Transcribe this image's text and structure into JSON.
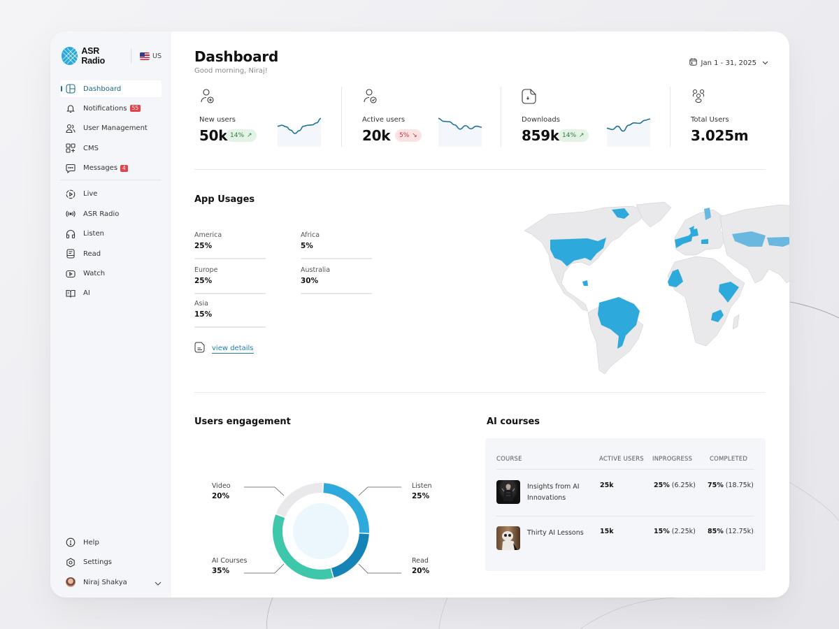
{
  "app": {
    "brand": "ASR Radio",
    "locale": "US"
  },
  "sidebar": {
    "primary": [
      {
        "label": "Dashboard",
        "icon": "layout-icon",
        "active": true
      },
      {
        "label": "Notifications",
        "icon": "bell-icon",
        "badge": "55"
      },
      {
        "label": "User Management",
        "icon": "users-icon"
      },
      {
        "label": "CMS",
        "icon": "grid-plus-icon"
      },
      {
        "label": "Messages",
        "icon": "message-icon",
        "badge": "4"
      }
    ],
    "secondary": [
      {
        "label": "Live",
        "icon": "live-play-icon"
      },
      {
        "label": "ASR Radio",
        "icon": "broadcast-icon"
      },
      {
        "label": "Listen",
        "icon": "headphones-icon"
      },
      {
        "label": "Read",
        "icon": "document-icon"
      },
      {
        "label": "Watch",
        "icon": "video-icon"
      },
      {
        "label": "AI",
        "icon": "book-open-icon"
      }
    ],
    "bottom": [
      {
        "label": "Help",
        "icon": "info-circle-icon"
      },
      {
        "label": "Settings",
        "icon": "settings-icon"
      }
    ],
    "user": {
      "name": "Niraj Shakya"
    }
  },
  "header": {
    "title": "Dashboard",
    "greeting": "Good morning, Niraj!",
    "date_range": "Jan 1 - 31, 2025"
  },
  "stats": [
    {
      "label": "New users",
      "value": "50k",
      "trend": "14%",
      "direction": "up",
      "icon": "user-add-icon",
      "spark": [
        0.55,
        0.6,
        0.52,
        0.35,
        0.18,
        0.32,
        0.55,
        0.6,
        0.62,
        0.72,
        0.95
      ]
    },
    {
      "label": "Active users",
      "value": "20k",
      "trend": "5%",
      "direction": "down",
      "icon": "user-check-icon",
      "spark": [
        0.95,
        0.8,
        0.78,
        0.62,
        0.4,
        0.58,
        0.42,
        0.55,
        0.5
      ]
    },
    {
      "label": "Downloads",
      "value": "859k",
      "trend": "14%",
      "direction": "up",
      "icon": "file-download-icon",
      "spark": [
        0.45,
        0.38,
        0.55,
        0.3,
        0.6,
        0.72,
        0.7,
        0.85,
        0.92
      ]
    },
    {
      "label": "Total Users",
      "value": "3.025m",
      "icon": "group-icon"
    }
  ],
  "app_usage": {
    "title": "App Usages",
    "regions": [
      {
        "name": "America",
        "value": "25%"
      },
      {
        "name": "Africa",
        "value": "5%"
      },
      {
        "name": "Europe",
        "value": "25%"
      },
      {
        "name": "Australia",
        "value": "30%"
      },
      {
        "name": "Asia",
        "value": "15%"
      }
    ],
    "link": "view details",
    "highlight_color": "#2ea9dc",
    "highlight_light": "#6ab8e0",
    "land_color": "#e9e9eb"
  },
  "engagement": {
    "title": "Users engagement",
    "segments": [
      {
        "name": "Listen",
        "value": 25,
        "label": "25%",
        "color": "#2ea9dc"
      },
      {
        "name": "Read",
        "value": 20,
        "label": "20%",
        "color": "#1683b7"
      },
      {
        "name": "AI Courses",
        "value": 35,
        "label": "35%",
        "color": "#3ec7ab"
      },
      {
        "name": "Video",
        "value": 20,
        "label": "20%",
        "color": "#e9e9eb"
      }
    ]
  },
  "ai_courses": {
    "title": "AI courses",
    "columns": [
      "COURSE",
      "ACTIVE USERS",
      "INPROGRESS",
      "COMPLETED"
    ],
    "rows": [
      {
        "course": "Insights from AI Innovations",
        "active_users": "25k",
        "inprogress_pct": "25%",
        "inprogress_count": "(6.25k)",
        "completed_pct": "75%",
        "completed_count": "(18.75k)"
      },
      {
        "course": "Thirty AI Lessons",
        "active_users": "15k",
        "inprogress_pct": "15%",
        "inprogress_count": "(2.25k)",
        "completed_pct": "85%",
        "completed_count": "(12.75k)"
      }
    ]
  }
}
